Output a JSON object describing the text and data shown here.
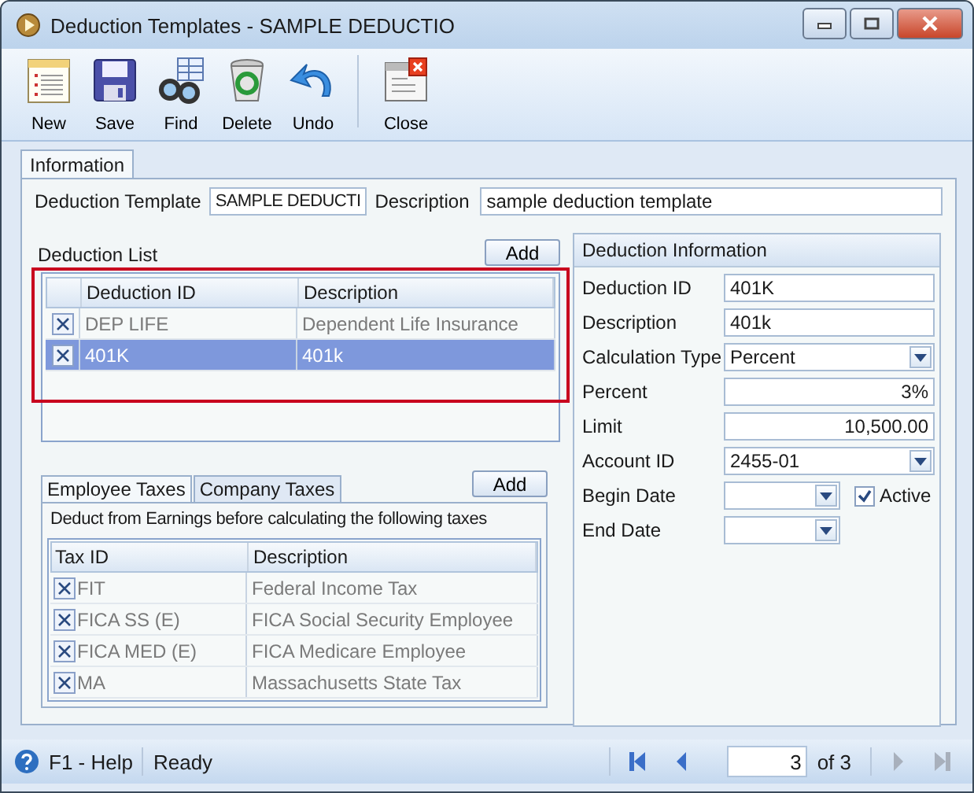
{
  "window": {
    "title": "Deduction Templates - SAMPLE DEDUCTIO"
  },
  "toolbar": [
    {
      "label": "New",
      "kind": "new"
    },
    {
      "label": "Save",
      "kind": "save"
    },
    {
      "label": "Find",
      "kind": "find"
    },
    {
      "label": "Delete",
      "kind": "delete"
    },
    {
      "label": "Undo",
      "kind": "undo"
    },
    {
      "label": "Close",
      "kind": "close"
    }
  ],
  "tabs": [
    {
      "label": "Information",
      "selected": true
    }
  ],
  "template": {
    "label": "Deduction Template",
    "value": "SAMPLE DEDUCTI"
  },
  "description": {
    "label": "Description",
    "value": "sample deduction template"
  },
  "deduction_list": {
    "title": "Deduction List",
    "add_button": "Add",
    "columns": [
      "Deduction ID",
      "Description"
    ],
    "rows": [
      {
        "id": "DEP LIFE",
        "description": "Dependent Life Insurance",
        "selected": false
      },
      {
        "id": "401K",
        "description": "401k",
        "selected": true
      }
    ]
  },
  "taxes": {
    "tabs": [
      {
        "label": "Employee Taxes",
        "selected": true
      },
      {
        "label": "Company Taxes",
        "selected": false
      }
    ],
    "add_button": "Add",
    "note": "Deduct from Earnings before calculating the following taxes",
    "columns": [
      "Tax ID",
      "Description"
    ],
    "rows": [
      {
        "id": "FIT",
        "description": "Federal Income Tax"
      },
      {
        "id": "FICA SS (E)",
        "description": "FICA Social Security Employee"
      },
      {
        "id": "FICA MED (E)",
        "description": "FICA Medicare Employee"
      },
      {
        "id": "MA",
        "description": "Massachusetts State Tax"
      }
    ]
  },
  "deduction_info": {
    "title": "Deduction Information",
    "fields": [
      {
        "label": "Deduction ID",
        "value": "401K",
        "kind": "text"
      },
      {
        "label": "Description",
        "value": "401k",
        "kind": "text"
      },
      {
        "label": "Calculation Type",
        "value": "Percent",
        "kind": "combo"
      },
      {
        "label": "Percent",
        "value": "3%",
        "kind": "number"
      },
      {
        "label": "Limit",
        "value": "10,500.00",
        "kind": "number"
      },
      {
        "label": "Account ID",
        "value": "2455-01",
        "kind": "combo"
      },
      {
        "label": "Begin Date",
        "kind": "date"
      },
      {
        "label": "End Date",
        "kind": "date"
      }
    ],
    "active": {
      "label": "Active",
      "checked": true
    }
  },
  "status_bar": {
    "help": "F1 - Help",
    "status": "Ready",
    "page": "3",
    "of": "of 3"
  }
}
